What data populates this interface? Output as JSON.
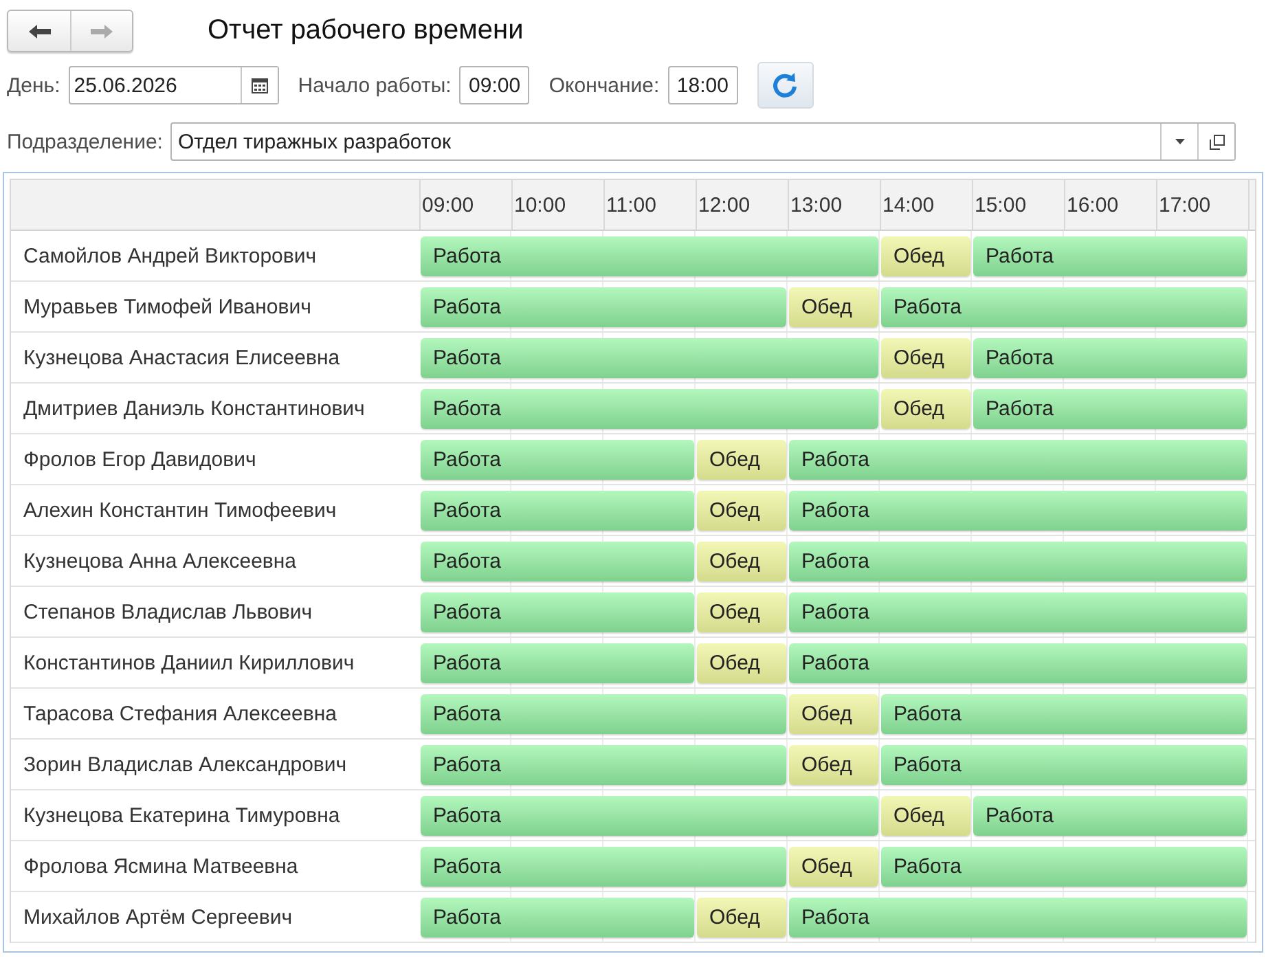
{
  "window": {
    "title": "Отчет рабочего времени"
  },
  "filters": {
    "day_label": "День:",
    "day": "25.06.2026",
    "start_label": "Начало работы:",
    "start": "09:00",
    "end_label": "Окончание:",
    "end": "18:00",
    "department_label": "Подразделение:",
    "department": "Отдел тиражных разработок"
  },
  "timeline": {
    "hours": [
      "09:00",
      "10:00",
      "11:00",
      "12:00",
      "13:00",
      "14:00",
      "15:00",
      "16:00",
      "17:00"
    ],
    "rows": [
      {
        "name": "Самойлов Андрей Викторович",
        "slots": [
          {
            "kind": "work",
            "label": "Работа"
          },
          {
            "kind": "work"
          },
          {
            "kind": "work"
          },
          {
            "kind": "work"
          },
          {
            "kind": "work"
          },
          {
            "kind": "lunch",
            "label": "Обед"
          },
          {
            "kind": "work",
            "label": "Работа"
          },
          {
            "kind": "work"
          },
          {
            "kind": "work"
          }
        ]
      },
      {
        "name": "Муравьев Тимофей Иванович",
        "slots": [
          {
            "kind": "work",
            "label": "Работа"
          },
          {
            "kind": "work"
          },
          {
            "kind": "work"
          },
          {
            "kind": "work"
          },
          {
            "kind": "lunch",
            "label": "Обед"
          },
          {
            "kind": "work",
            "label": "Работа"
          },
          {
            "kind": "work"
          },
          {
            "kind": "work"
          },
          {
            "kind": "work"
          }
        ]
      },
      {
        "name": "Кузнецова Анастасия Елисеевна",
        "slots": [
          {
            "kind": "work",
            "label": "Работа"
          },
          {
            "kind": "work"
          },
          {
            "kind": "work"
          },
          {
            "kind": "work"
          },
          {
            "kind": "work"
          },
          {
            "kind": "lunch",
            "label": "Обед"
          },
          {
            "kind": "work",
            "label": "Работа"
          },
          {
            "kind": "work"
          },
          {
            "kind": "work"
          }
        ]
      },
      {
        "name": "Дмитриев Даниэль Константинович",
        "slots": [
          {
            "kind": "work",
            "label": "Работа"
          },
          {
            "kind": "work"
          },
          {
            "kind": "work"
          },
          {
            "kind": "work"
          },
          {
            "kind": "work"
          },
          {
            "kind": "lunch",
            "label": "Обед"
          },
          {
            "kind": "work",
            "label": "Работа"
          },
          {
            "kind": "work"
          },
          {
            "kind": "work"
          }
        ]
      },
      {
        "name": "Фролов Егор Давидович",
        "slots": [
          {
            "kind": "work",
            "label": "Работа"
          },
          {
            "kind": "work"
          },
          {
            "kind": "work"
          },
          {
            "kind": "lunch",
            "label": "Обед"
          },
          {
            "kind": "work",
            "label": "Работа"
          },
          {
            "kind": "work"
          },
          {
            "kind": "work"
          },
          {
            "kind": "work"
          },
          {
            "kind": "work"
          }
        ]
      },
      {
        "name": "Алехин Константин Тимофеевич",
        "slots": [
          {
            "kind": "work",
            "label": "Работа"
          },
          {
            "kind": "work"
          },
          {
            "kind": "work"
          },
          {
            "kind": "lunch",
            "label": "Обед"
          },
          {
            "kind": "work",
            "label": "Работа"
          },
          {
            "kind": "work"
          },
          {
            "kind": "work"
          },
          {
            "kind": "work"
          },
          {
            "kind": "work"
          }
        ]
      },
      {
        "name": "Кузнецова Анна Алексеевна",
        "slots": [
          {
            "kind": "work",
            "label": "Работа"
          },
          {
            "kind": "work"
          },
          {
            "kind": "work"
          },
          {
            "kind": "lunch",
            "label": "Обед"
          },
          {
            "kind": "work",
            "label": "Работа"
          },
          {
            "kind": "work"
          },
          {
            "kind": "work"
          },
          {
            "kind": "work"
          },
          {
            "kind": "work"
          }
        ]
      },
      {
        "name": "Степанов Владислав Львович",
        "slots": [
          {
            "kind": "work",
            "label": "Работа"
          },
          {
            "kind": "work"
          },
          {
            "kind": "work"
          },
          {
            "kind": "lunch",
            "label": "Обед"
          },
          {
            "kind": "work",
            "label": "Работа"
          },
          {
            "kind": "work"
          },
          {
            "kind": "work"
          },
          {
            "kind": "work"
          },
          {
            "kind": "work"
          }
        ]
      },
      {
        "name": "Константинов Даниил Кириллович",
        "slots": [
          {
            "kind": "work",
            "label": "Работа"
          },
          {
            "kind": "work"
          },
          {
            "kind": "work"
          },
          {
            "kind": "lunch",
            "label": "Обед"
          },
          {
            "kind": "work",
            "label": "Работа"
          },
          {
            "kind": "work"
          },
          {
            "kind": "work"
          },
          {
            "kind": "work"
          },
          {
            "kind": "work"
          }
        ]
      },
      {
        "name": "Тарасова Стефания Алексеевна",
        "slots": [
          {
            "kind": "work",
            "label": "Работа"
          },
          {
            "kind": "work"
          },
          {
            "kind": "work"
          },
          {
            "kind": "work"
          },
          {
            "kind": "lunch",
            "label": "Обед"
          },
          {
            "kind": "work",
            "label": "Работа"
          },
          {
            "kind": "work"
          },
          {
            "kind": "work"
          },
          {
            "kind": "work"
          }
        ]
      },
      {
        "name": "Зорин Владислав Александрович",
        "slots": [
          {
            "kind": "work",
            "label": "Работа"
          },
          {
            "kind": "work"
          },
          {
            "kind": "work"
          },
          {
            "kind": "work"
          },
          {
            "kind": "lunch",
            "label": "Обед"
          },
          {
            "kind": "work",
            "label": "Работа"
          },
          {
            "kind": "work"
          },
          {
            "kind": "work"
          },
          {
            "kind": "work"
          }
        ]
      },
      {
        "name": "Кузнецова Екатерина Тимуровна",
        "slots": [
          {
            "kind": "work",
            "label": "Работа"
          },
          {
            "kind": "work"
          },
          {
            "kind": "work"
          },
          {
            "kind": "work"
          },
          {
            "kind": "work"
          },
          {
            "kind": "lunch",
            "label": "Обед"
          },
          {
            "kind": "work",
            "label": "Работа"
          },
          {
            "kind": "work"
          },
          {
            "kind": "work"
          }
        ]
      },
      {
        "name": "Фролова Ясмина Матвеевна",
        "slots": [
          {
            "kind": "work",
            "label": "Работа"
          },
          {
            "kind": "work"
          },
          {
            "kind": "work"
          },
          {
            "kind": "work"
          },
          {
            "kind": "lunch",
            "label": "Обед"
          },
          {
            "kind": "work",
            "label": "Работа"
          },
          {
            "kind": "work"
          },
          {
            "kind": "work"
          },
          {
            "kind": "work"
          }
        ]
      },
      {
        "name": "Михайлов Артём Сергеевич",
        "slots": [
          {
            "kind": "work",
            "label": "Работа"
          },
          {
            "kind": "work"
          },
          {
            "kind": "work"
          },
          {
            "kind": "lunch",
            "label": "Обед"
          },
          {
            "kind": "work",
            "label": "Работа"
          },
          {
            "kind": "work"
          },
          {
            "kind": "work"
          },
          {
            "kind": "work"
          },
          {
            "kind": "work"
          }
        ]
      }
    ]
  }
}
